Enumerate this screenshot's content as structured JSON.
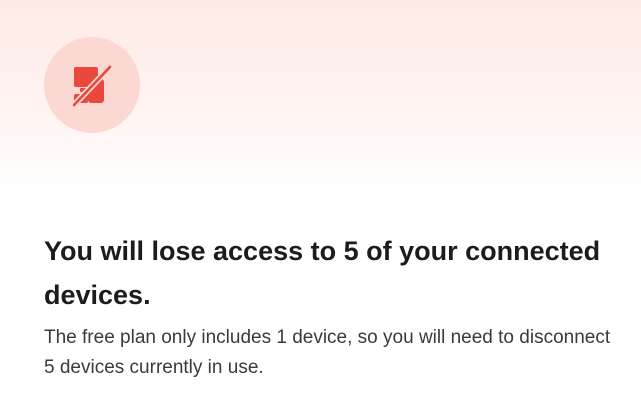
{
  "dialog": {
    "icon": "devices-disconnected-icon",
    "title": "You will lose access to 5 of your connected devices.",
    "description": "The free plan only includes 1 device, so you will need to disconnect 5 devices currently in use."
  },
  "colors": {
    "accent": "#e8493c",
    "icon_background": "#fbd8d2",
    "hero_gradient_top": "#fdeae6"
  }
}
